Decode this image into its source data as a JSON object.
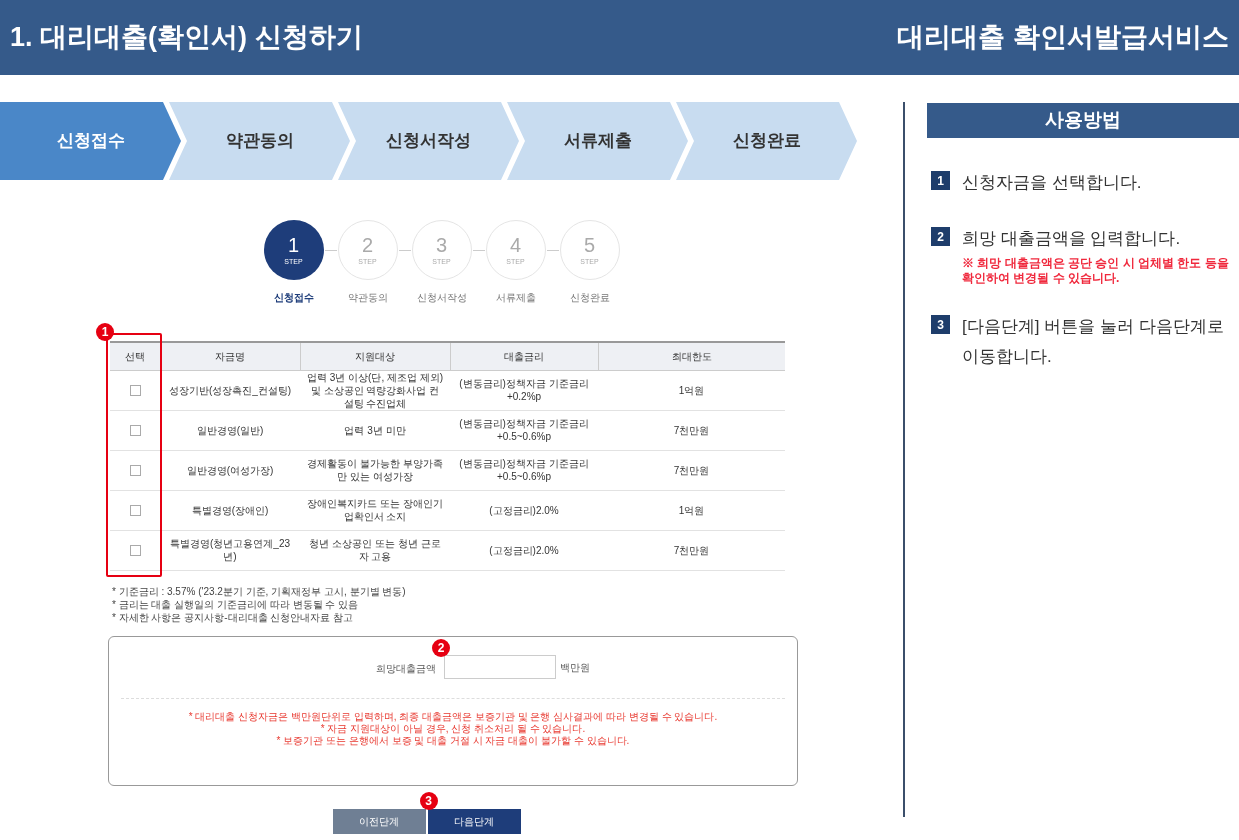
{
  "header": {
    "title": "1. 대리대출(확인서) 신청하기",
    "service": "대리대출 확인서발급서비스"
  },
  "progress": [
    {
      "label": "신청접수",
      "selected": true
    },
    {
      "label": "약관동의",
      "selected": false
    },
    {
      "label": "신청서작성",
      "selected": false
    },
    {
      "label": "서류제출",
      "selected": false
    },
    {
      "label": "신청완료",
      "selected": false
    }
  ],
  "steps": [
    {
      "number": "1",
      "step_label": "STEP",
      "caption": "신청접수",
      "selected": true
    },
    {
      "number": "2",
      "step_label": "STEP",
      "caption": "약관동의",
      "selected": false
    },
    {
      "number": "3",
      "step_label": "STEP",
      "caption": "신청서작성",
      "selected": false
    },
    {
      "number": "4",
      "step_label": "STEP",
      "caption": "서류제출",
      "selected": false
    },
    {
      "number": "5",
      "step_label": "STEP",
      "caption": "신청완료",
      "selected": false
    }
  ],
  "table": {
    "annotation": "1",
    "select_header": "선택",
    "columns": [
      "자금명",
      "지원대상",
      "대출금리",
      "최대한도"
    ],
    "rows": [
      {
        "checked": false,
        "cells": [
          "성장기반(성장촉진_컨설팅)",
          "업력 3년 이상(단, 제조업 제외) 및 소상공인 역량강화사업 컨설팅 수진업체",
          "(변동금리)정책자금 기준금리+0.2%p",
          "1억원"
        ]
      },
      {
        "checked": false,
        "cells": [
          "일반경영(일반)",
          "업력 3년 미만",
          "(변동금리)정책자금 기준금리+0.5~0.6%p",
          "7천만원"
        ]
      },
      {
        "checked": false,
        "cells": [
          "일반경영(여성가장)",
          "경제활동이 불가능한 부양가족만 있는 여성가장",
          "(변동금리)정책자금 기준금리+0.5~0.6%p",
          "7천만원"
        ]
      },
      {
        "checked": false,
        "cells": [
          "특별경영(장애인)",
          "장애인복지카드 또는 장애인기업확인서 소지",
          "(고정금리)2.0%",
          "1억원"
        ]
      },
      {
        "checked": false,
        "cells": [
          "특별경영(청년고용연계_23년)",
          "청년 소상공인 또는 청년 근로자 고용",
          "(고정금리)2.0%",
          "7천만원"
        ]
      }
    ]
  },
  "notes": [
    "* 기준금리 : 3.57% ('23.2분기 기준, 기획재정부 고시, 분기별 변동)",
    "* 금리는 대출 실행일의 기준금리에 따라 변동될 수 있음",
    "* 자세한 사항은 공지사항-대리대출 신청안내자료 참고"
  ],
  "amount_form": {
    "annotation": "2",
    "label": "희망대출금액",
    "unit": "백만원",
    "notices": [
      "* 대리대출 신청자금은 백만원단위로 입력하며, 최종 대출금액은 보증기관 및 은행 심사결과에 따라 변경될 수 있습니다.",
      "* 자금 지원대상이 아닐 경우, 신청 취소처리 될 수 있습니다.",
      "* 보증기관 또는 은행에서 보증 및 대출 거절 시 자금 대출이 불가할 수 있습니다."
    ]
  },
  "buttons": [
    {
      "label": "이전단계",
      "kind": "secondary"
    },
    {
      "label": "다음단계",
      "kind": "primary",
      "annotation": "3"
    }
  ],
  "guide": {
    "title": "사용방법",
    "items": [
      {
        "number": "1",
        "text": "신청자금을 선택합니다."
      },
      {
        "number": "2",
        "text": "희망 대출금액을 입력합니다.",
        "note": "※ 희망 대출금액은 공단 승인 시 업체별 한도 등을 확인하여 변경될 수 있습니다."
      },
      {
        "number": "3",
        "text": "[다음단계] 버튼을 눌러 다음단계로 이동합니다."
      }
    ]
  }
}
